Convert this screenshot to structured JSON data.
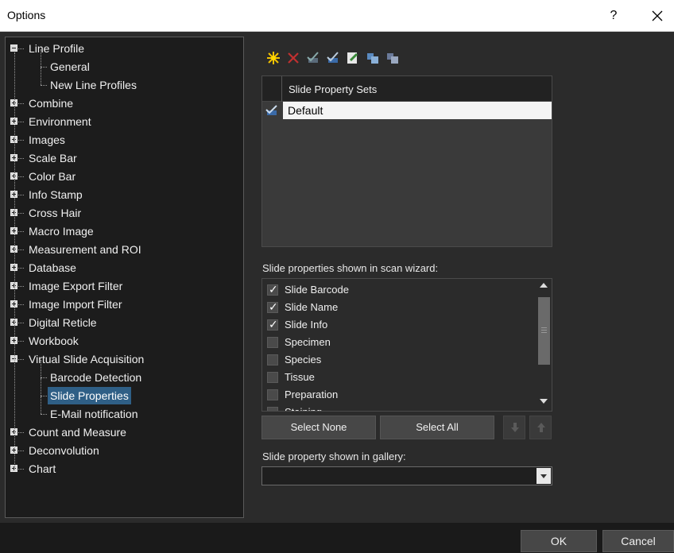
{
  "window": {
    "title": "Options",
    "help_label": "?",
    "close_label": "✕"
  },
  "tree": {
    "items": [
      {
        "label": "Line Profile",
        "state": "expanded"
      },
      {
        "label": "General",
        "state": "child"
      },
      {
        "label": "New Line Profiles",
        "state": "child"
      },
      {
        "label": "Combine",
        "state": "collapsed"
      },
      {
        "label": "Environment",
        "state": "collapsed"
      },
      {
        "label": "Images",
        "state": "collapsed"
      },
      {
        "label": "Scale Bar",
        "state": "collapsed"
      },
      {
        "label": "Color Bar",
        "state": "collapsed"
      },
      {
        "label": "Info Stamp",
        "state": "collapsed"
      },
      {
        "label": "Cross Hair",
        "state": "collapsed"
      },
      {
        "label": "Macro Image",
        "state": "collapsed"
      },
      {
        "label": "Measurement and ROI",
        "state": "collapsed"
      },
      {
        "label": "Database",
        "state": "collapsed"
      },
      {
        "label": "Image Export Filter",
        "state": "collapsed"
      },
      {
        "label": "Image Import Filter",
        "state": "collapsed"
      },
      {
        "label": "Digital Reticle",
        "state": "collapsed"
      },
      {
        "label": "Workbook",
        "state": "collapsed"
      },
      {
        "label": "Virtual Slide Acquisition",
        "state": "expanded"
      },
      {
        "label": "Barcode Detection",
        "state": "child"
      },
      {
        "label": "Slide Properties",
        "state": "child-selected"
      },
      {
        "label": "E-Mail notification",
        "state": "child"
      },
      {
        "label": "Count and Measure",
        "state": "collapsed"
      },
      {
        "label": "Deconvolution",
        "state": "collapsed"
      },
      {
        "label": "Chart",
        "state": "collapsed"
      }
    ]
  },
  "toolbar": {
    "icons": [
      "new-icon",
      "delete-icon",
      "edit-icon",
      "set-default-icon",
      "properties-icon",
      "import-icon",
      "export-icon"
    ]
  },
  "property_sets": {
    "column_header": "Slide Property Sets",
    "rows": [
      {
        "name": "Default",
        "is_default": true
      }
    ]
  },
  "scan_wizard": {
    "label": "Slide properties shown in scan wizard:",
    "items": [
      {
        "label": "Slide Barcode",
        "checked": true
      },
      {
        "label": "Slide Name",
        "checked": true
      },
      {
        "label": "Slide Info",
        "checked": true
      },
      {
        "label": "Specimen",
        "checked": false
      },
      {
        "label": "Species",
        "checked": false
      },
      {
        "label": "Tissue",
        "checked": false
      },
      {
        "label": "Preparation",
        "checked": false
      },
      {
        "label": "Staining",
        "checked": false
      }
    ],
    "select_none_label": "Select None",
    "select_all_label": "Select All"
  },
  "gallery": {
    "label": "Slide property shown in gallery:",
    "value": ""
  },
  "footer": {
    "ok_label": "OK",
    "cancel_label": "Cancel"
  },
  "colors": {
    "background": "#2b2b2b",
    "tree_background": "#1c1c1c",
    "selection": "#2f5f86"
  }
}
